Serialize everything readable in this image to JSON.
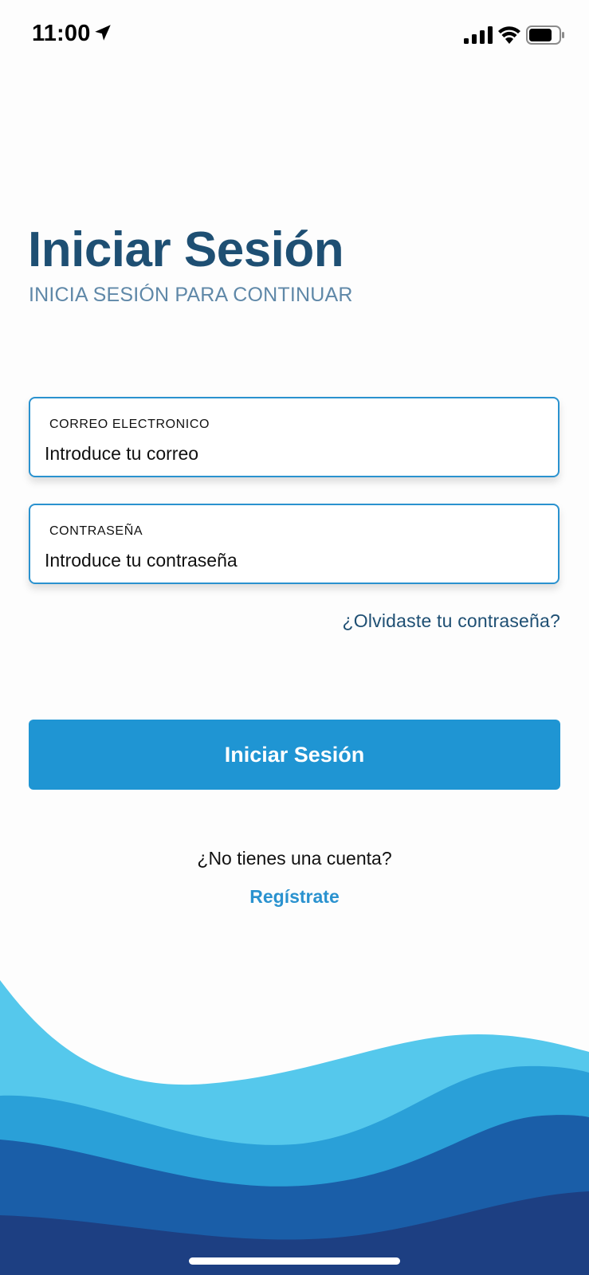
{
  "status_bar": {
    "time": "11:00",
    "icons": [
      "location-arrow-icon",
      "cellular-signal-icon",
      "wifi-icon",
      "battery-icon"
    ]
  },
  "header": {
    "title": "Iniciar Sesión",
    "subtitle": "INICIA SESIÓN PARA CONTINUAR"
  },
  "form": {
    "email": {
      "label": "CORREO ELECTRONICO",
      "placeholder": "Introduce tu correo",
      "value": ""
    },
    "password": {
      "label": "CONTRASEÑA",
      "placeholder": "Introduce tu contraseña",
      "value": ""
    },
    "forgot_password_label": "¿Olvidaste tu contraseña?",
    "submit_label": "Iniciar Sesión"
  },
  "signup": {
    "prompt": "¿No tienes una cuenta?",
    "link_label": "Regístrate"
  },
  "colors": {
    "title": "#1e4f73",
    "subtitle": "#5f88a8",
    "accent": "#1f95d3",
    "wave_light": "#55c8ec",
    "wave_mid": "#2aa0d8",
    "wave_deep": "#1a5ea8",
    "wave_darkest": "#1d3f82"
  }
}
